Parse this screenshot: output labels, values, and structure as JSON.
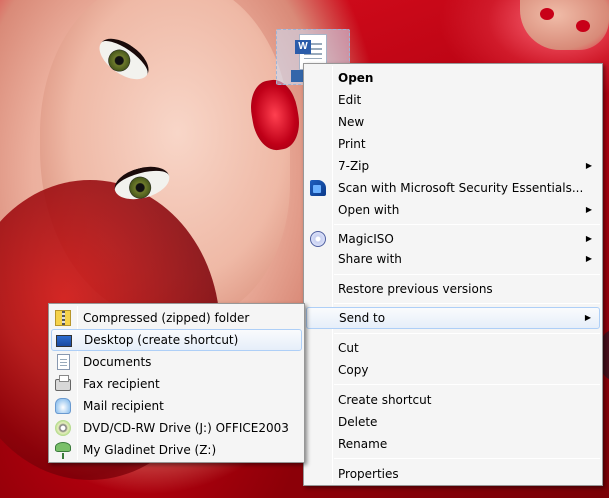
{
  "desktop": {
    "selected_file_icon": "word-document-icon"
  },
  "context_menu": {
    "items": [
      {
        "label": "Open",
        "bold": true
      },
      {
        "label": "Edit"
      },
      {
        "label": "New"
      },
      {
        "label": "Print"
      },
      {
        "label": "7-Zip",
        "submenu": true
      },
      {
        "label": "Scan with Microsoft Security Essentials...",
        "icon": "security-essentials-icon"
      },
      {
        "label": "Open with",
        "submenu": true
      },
      {
        "label": "MagicISO",
        "icon": "magiciso-icon",
        "submenu": true
      },
      {
        "label": "Share with",
        "submenu": true
      },
      {
        "label": "Restore previous versions"
      },
      {
        "label": "Send to",
        "submenu": true,
        "highlighted": true
      },
      {
        "label": "Cut"
      },
      {
        "label": "Copy"
      },
      {
        "label": "Create shortcut"
      },
      {
        "label": "Delete"
      },
      {
        "label": "Rename"
      },
      {
        "label": "Properties"
      }
    ]
  },
  "send_to_menu": {
    "items": [
      {
        "label": "Compressed (zipped) folder",
        "icon": "zip-folder-icon"
      },
      {
        "label": "Desktop (create shortcut)",
        "icon": "desktop-icon",
        "highlighted": true
      },
      {
        "label": "Documents",
        "icon": "documents-icon"
      },
      {
        "label": "Fax recipient",
        "icon": "fax-icon"
      },
      {
        "label": "Mail recipient",
        "icon": "mail-icon"
      },
      {
        "label": "DVD/CD-RW Drive (J:) OFFICE2003",
        "icon": "dvd-drive-icon"
      },
      {
        "label": "My Gladinet Drive (Z:)",
        "icon": "network-drive-icon"
      }
    ]
  },
  "colors": {
    "menu_background": "#f5f5f5",
    "highlight_border": "#aecff7",
    "wallpaper_red": "#c00010"
  }
}
